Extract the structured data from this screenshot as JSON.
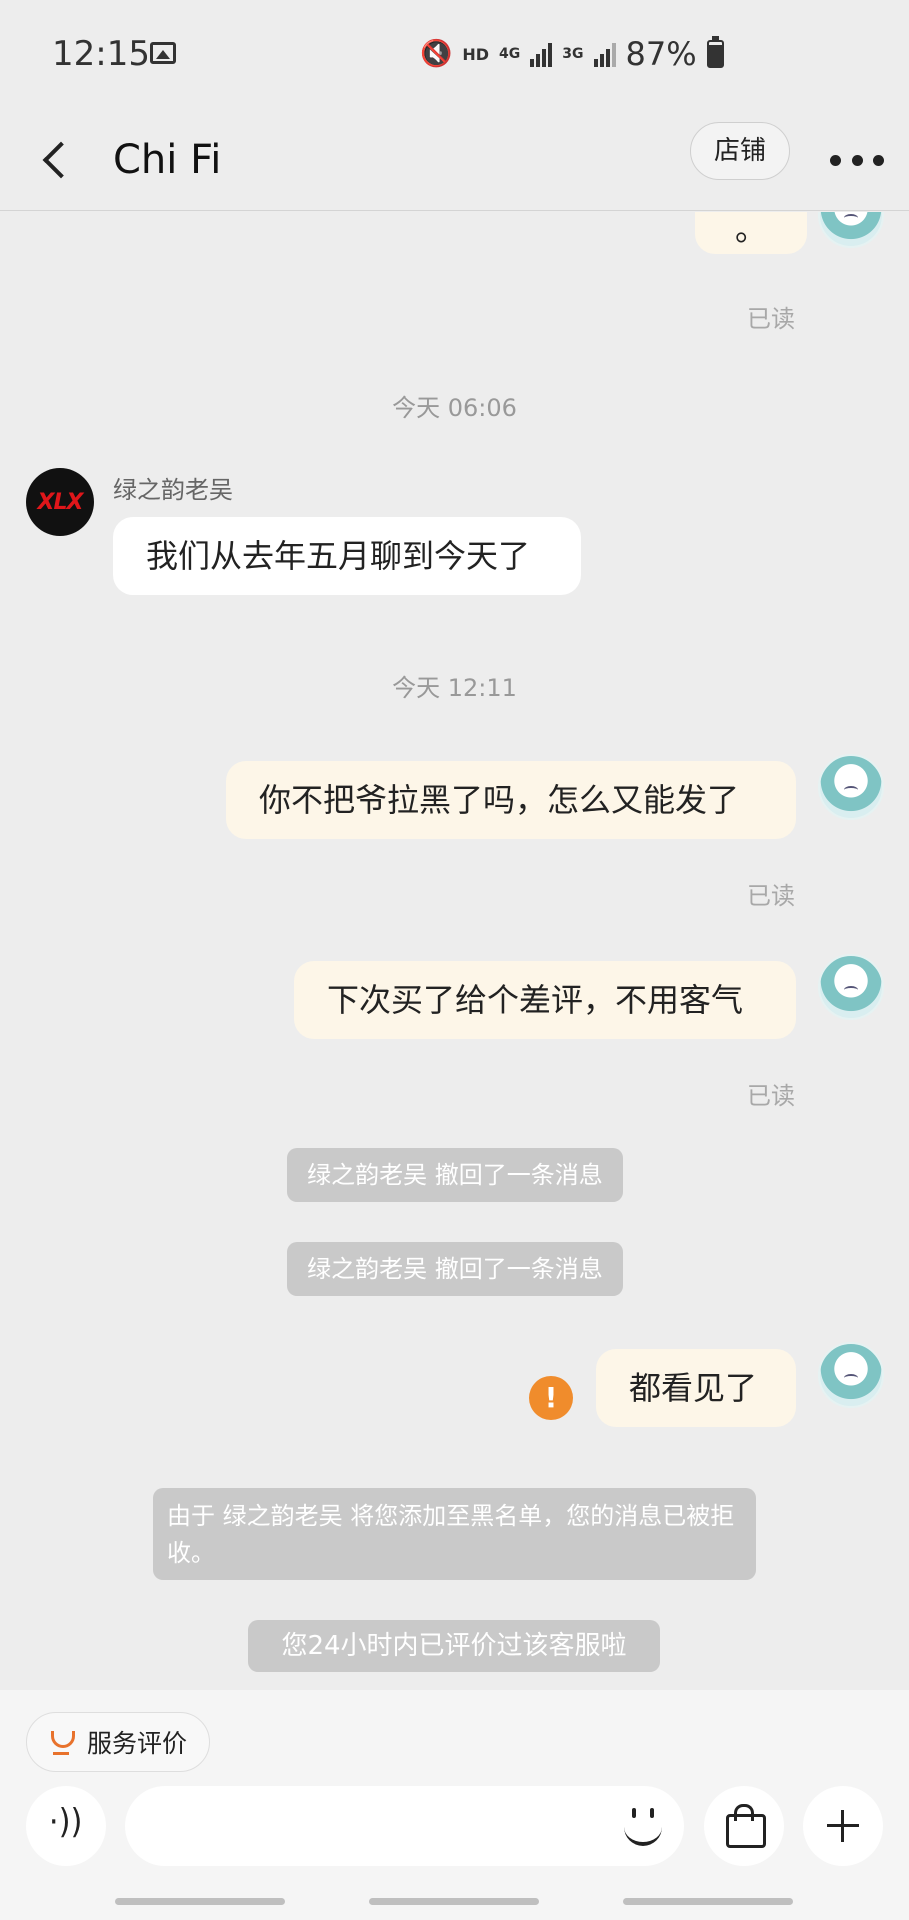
{
  "status_bar": {
    "time": "12:15",
    "hd": "HD",
    "network_4g": "4G",
    "network_3g": "3G",
    "battery": "87%"
  },
  "header": {
    "title": "Chi Fi",
    "shop_label": "店铺"
  },
  "chat": {
    "partial_message": "。",
    "read_label": "已读",
    "time_1": "今天  06:06",
    "sender_name": "绿之韵老吴",
    "sender_avatar_text": "XLX",
    "incoming_message": "我们从去年五月聊到今天了",
    "time_2": "今天  12:11",
    "outgoing_1": "你不把爷拉黑了吗，怎么又能发了",
    "outgoing_2": "下次买了给个差评，不用客气",
    "recall_1": "绿之韵老吴 撤回了一条消息",
    "recall_2": "绿之韵老吴 撤回了一条消息",
    "outgoing_3": "都看见了",
    "failed_icon": "!",
    "blacklist_notice": "由于 绿之韵老吴 将您添加至黑名单，您的消息已被拒收。",
    "rated_notice": "您24小时内已评价过该客服啦"
  },
  "bottom": {
    "rating_label": "服务评价",
    "voice_icon": "·))",
    "input_value": ""
  },
  "colors": {
    "background": "#ededed",
    "outgoing_bubble": "#fdf6e8",
    "incoming_bubble": "#ffffff",
    "system_pill": "#c9c9c9",
    "warning": "#f08c2c",
    "avatar_red": "#e0161a"
  }
}
